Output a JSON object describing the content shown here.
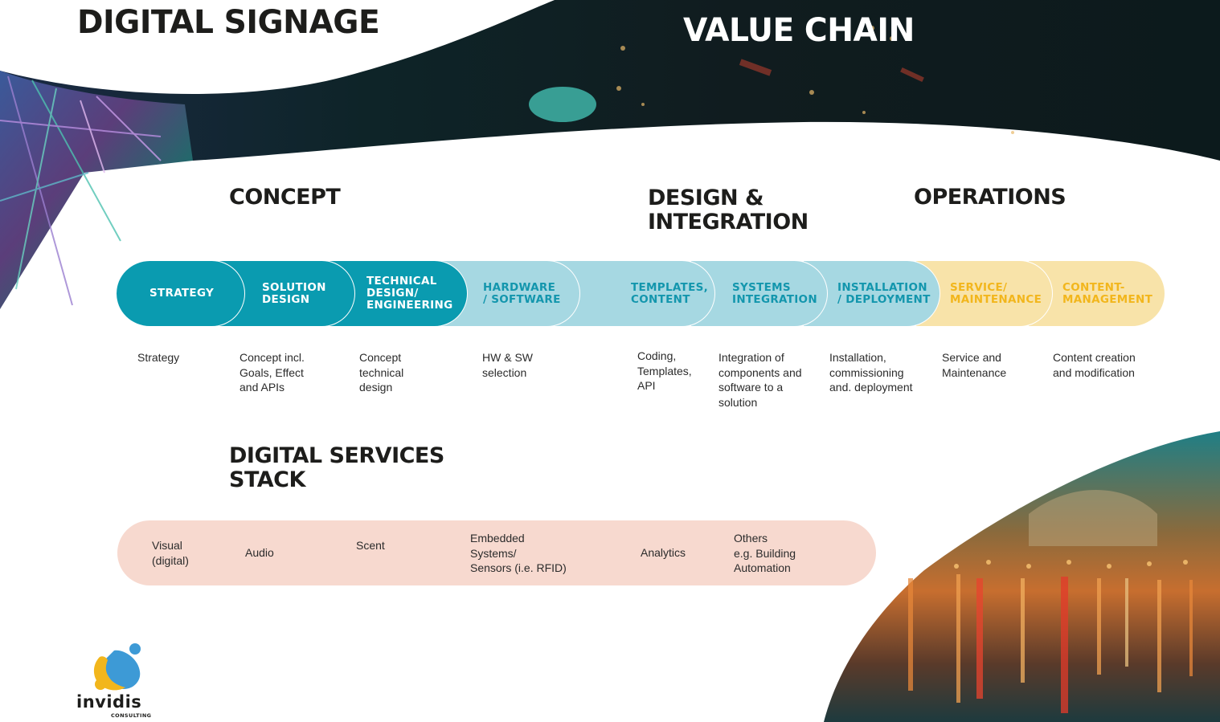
{
  "header": {
    "title_left": "DIGITAL SIGNAGE",
    "title_right": "VALUE CHAIN"
  },
  "phases": {
    "concept": "CONCEPT",
    "design_integration": "DESIGN &\nINTEGRATION",
    "operations": "OPERATIONS"
  },
  "chain": {
    "segments": [
      {
        "label": "STRATEGY",
        "tone": "dark",
        "description": "Strategy"
      },
      {
        "label": "SOLUTION\nDESIGN",
        "tone": "dark",
        "description": "Concept incl.\nGoals, Effect\nand APIs"
      },
      {
        "label": "TECHNICAL\nDESIGN/\nENGINEERING",
        "tone": "dark",
        "description": "Concept\ntechnical\ndesign"
      },
      {
        "label": "HARDWARE\n/ SOFTWARE",
        "tone": "light",
        "description": "HW & SW\nselection"
      },
      {
        "label": "TEMPLATES,\nCONTENT",
        "tone": "light",
        "description": "Coding,\nTemplates,\nAPI"
      },
      {
        "label": "SYSTEMS\nINTEGRATION",
        "tone": "light",
        "description": "Integration of\ncomponents and\nsoftware to a\nsolution"
      },
      {
        "label": "INSTALLATION\n/ DEPLOYMENT",
        "tone": "light",
        "description": "Installation,\ncommissioning\nand. deployment"
      },
      {
        "label": "SERVICE/\nMAINTENANCE",
        "tone": "yellow",
        "description": "Service and\nMaintenance"
      },
      {
        "label": "CONTENT-\nMANAGEMENT",
        "tone": "yellow",
        "description": "Content creation\nand modification"
      }
    ]
  },
  "stack": {
    "title": "DIGITAL SERVICES\nSTACK",
    "items": [
      "Visual\n(digital)",
      "Audio",
      "Scent",
      "Embedded\nSystems/\nSensors (i.e. RFID)",
      "Analytics",
      "Others\ne.g. Building\nAutomation"
    ]
  },
  "logo": {
    "name": "invidis",
    "subtitle": "CONSULTING"
  },
  "colors": {
    "dark_teal": "#0a9bb0",
    "light_teal": "#a6d8e2",
    "light_teal_text": "#1396ad",
    "yellow_fill": "#f8e3a9",
    "yellow_text": "#f2b61c",
    "stack_fill": "#f7d9cf",
    "logo_yellow": "#f2b61c",
    "logo_blue": "#3d9ad6"
  }
}
